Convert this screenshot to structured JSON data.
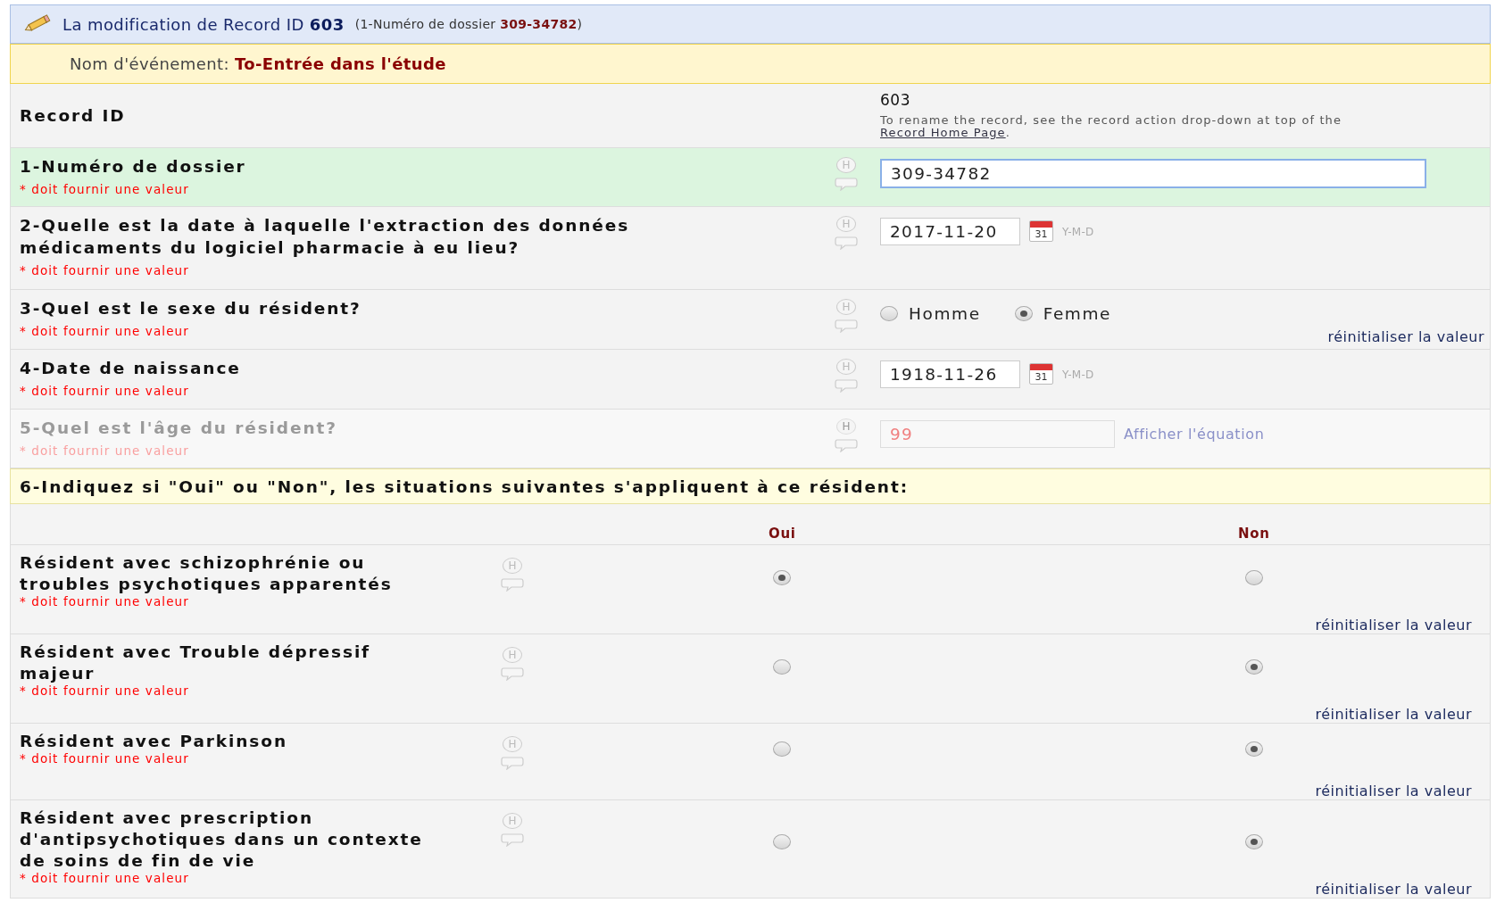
{
  "header": {
    "title": "La modification de Record ID **603**",
    "subtitle": "(1-Numéro de dossier **309-34782**)"
  },
  "event": {
    "label": "Nom d'événement:",
    "name": "To-Entrée dans l'étude"
  },
  "record_id": {
    "label": "Record ID",
    "value": "603",
    "note": "To rename the record, see the record action drop-down at top of the",
    "link": "Record Home Page",
    "note_end": "."
  },
  "fields": [
    {
      "kind": "text",
      "label": "1-Numéro de dossier",
      "required": "* doit fournir une valeur",
      "history": "H",
      "value": "309-34782",
      "highlighted": true,
      "disabled": false
    },
    {
      "kind": "date",
      "label": "2-Quelle est la date à laquelle l'extraction des données médicaments du logiciel pharmacie à eu lieu?",
      "required": "* doit fournir une valeur",
      "history": "H",
      "value": "2017-11-20",
      "calendar": "31",
      "format": "Y-M-D",
      "highlighted": false,
      "disabled": false
    },
    {
      "kind": "radio",
      "label": "3-Quel est le sexe du résident?",
      "required": "* doit fournir une valeur",
      "history": "H",
      "options": [
        {
          "label": "Homme",
          "selected": false
        },
        {
          "label": "Femme",
          "selected": true
        }
      ],
      "reset": "réinitialiser la valeur",
      "highlighted": false,
      "disabled": false
    },
    {
      "kind": "date",
      "label": "4-Date de naissance",
      "required": "* doit fournir une valeur",
      "history": "H",
      "value": "1918-11-26",
      "calendar": "31",
      "format": "Y-M-D",
      "highlighted": false,
      "disabled": false
    },
    {
      "kind": "calc",
      "label": "5-Quel est l'âge du résident?",
      "required": "* doit fournir une valeur",
      "history": "H",
      "value": "99",
      "link": "Afficher l'équation",
      "highlighted": false,
      "disabled": true
    }
  ],
  "matrix": {
    "title": "6-Indiquez si \"Oui\" ou \"Non\", les situations suivantes s'appliquent à ce résident:",
    "columns": [
      "Oui",
      "Non"
    ],
    "rows": [
      {
        "label": "Résident avec schizophrénie ou troubles psychotiques apparentés",
        "required": "* doit fournir une valeur",
        "history": "H",
        "choices": [
          {
            "selected": true
          },
          {
            "selected": false
          }
        ],
        "reset": "réinitialiser la valeur"
      },
      {
        "label": "Résident avec Trouble dépressif majeur",
        "required": "* doit fournir une valeur",
        "history": "H",
        "choices": [
          {
            "selected": false
          },
          {
            "selected": true
          }
        ],
        "reset": "réinitialiser la valeur"
      },
      {
        "label": "Résident avec Parkinson",
        "required": "* doit fournir une valeur",
        "history": "H",
        "choices": [
          {
            "selected": false
          },
          {
            "selected": true
          }
        ],
        "reset": "réinitialiser la valeur"
      },
      {
        "label": "Résident avec prescription d'antipsychotiques dans un contexte de soins de fin de vie",
        "required": "* doit fournir une valeur",
        "history": "H",
        "choices": [
          {
            "selected": false
          },
          {
            "selected": true
          }
        ],
        "reset": "réinitialiser la valeur"
      }
    ]
  }
}
